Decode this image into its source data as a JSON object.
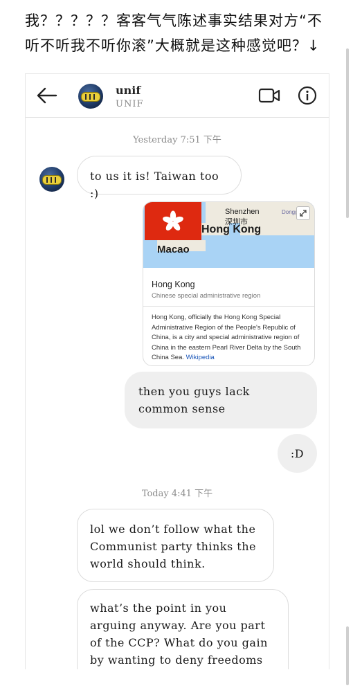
{
  "caption": {
    "line1": "我？？？？？客客气气陈述事实结果对方“不",
    "line2": "听不听我不听你滚”大概就是这种感觉吧？↓"
  },
  "header": {
    "username": "unif",
    "subtitle": "UNIF",
    "back_icon": "arrow-left-icon",
    "video_icon": "video-call-icon",
    "info_icon": "info-icon"
  },
  "thread": {
    "timestamp_1": "Yesterday 7:51 下午",
    "msg_1": "to us it is! Taiwan too :)",
    "card": {
      "map_label_shenzhen": "Shenzhen",
      "map_label_shenzhen_cn": "深圳市",
      "map_label_hk": "Hong Kong",
      "map_label_macao": "Macao",
      "map_label_dongguan": "Dongg",
      "title": "Hong Kong",
      "subtitle": "Chinese special administrative region",
      "body": "Hong Kong, officially the Hong Kong Special Administrative Region of the People's Republic of China, is a city and special administrative region of China in the eastern Pearl River Delta by the South China Sea.",
      "source": "Wikipedia"
    },
    "msg_2": "then you guys lack common sense",
    "msg_3": ":D",
    "timestamp_2": "Today 4:41 下午",
    "msg_4": "lol we don’t follow what the Communist party thinks the world should think.",
    "msg_5": "what’s the point in you arguing anyway. Are you part of the CCP? What do you gain by wanting to deny freedoms to"
  },
  "colors": {
    "incoming_bubble_border": "#dcdcdc",
    "outgoing_bubble_bg": "#efefef",
    "flag_red": "#de2910",
    "link_blue": "#1a56b8"
  }
}
